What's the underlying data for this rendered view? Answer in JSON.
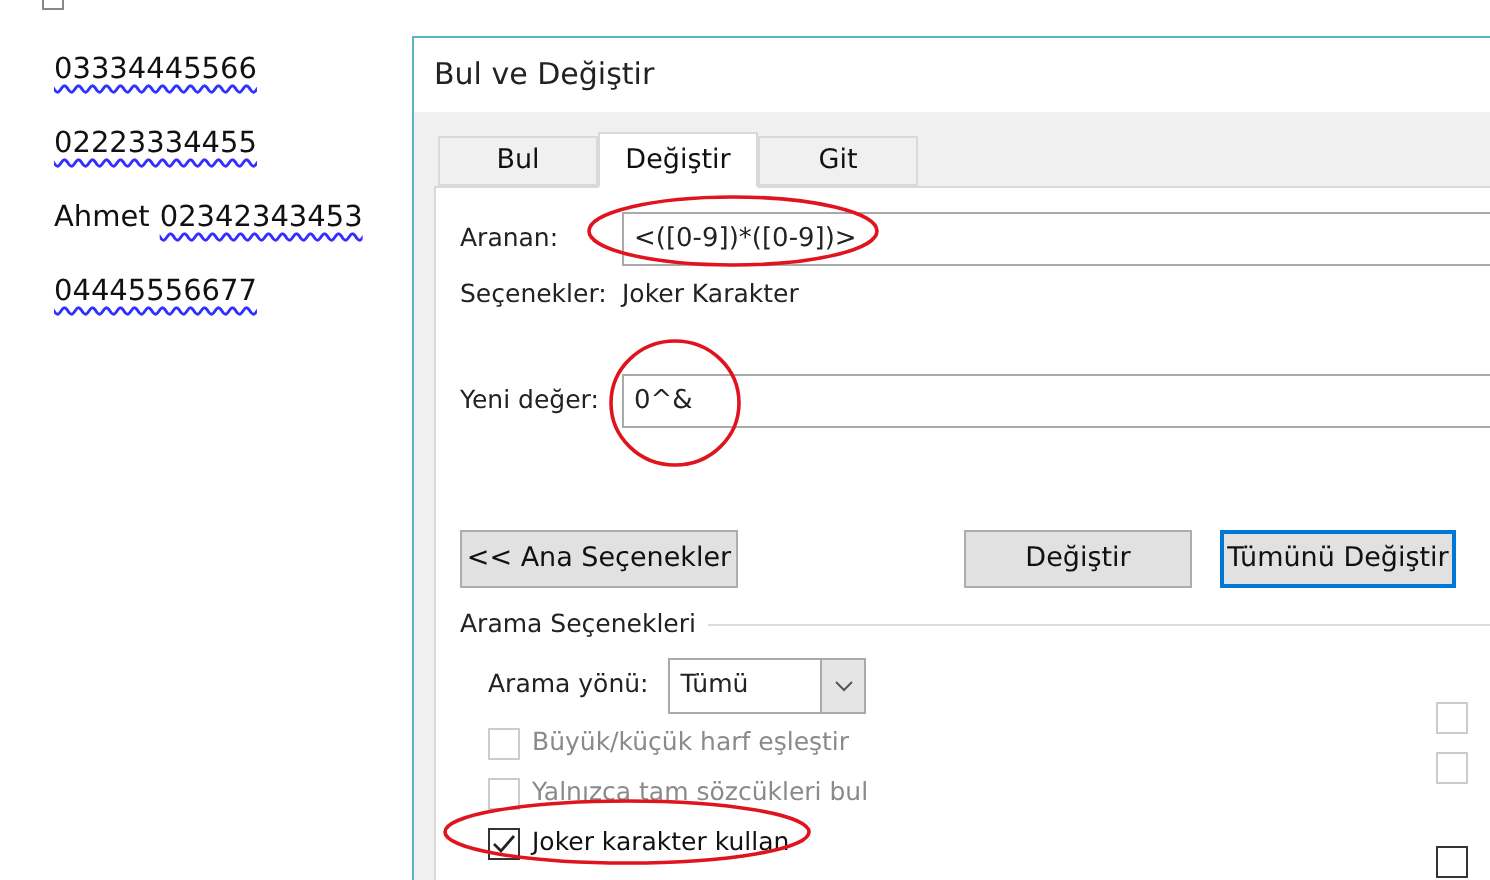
{
  "document": {
    "paragraphs": [
      {
        "words": [
          {
            "text": "03334445566",
            "flagged": true
          }
        ]
      },
      {
        "words": [
          {
            "text": "02223334455",
            "flagged": true
          }
        ]
      },
      {
        "words": [
          {
            "text": "Ahmet",
            "flagged": false
          },
          {
            "text": "02342343453",
            "flagged": true
          }
        ]
      },
      {
        "words": [
          {
            "text": "04445556677",
            "flagged": true
          }
        ]
      }
    ]
  },
  "dialog": {
    "title": "Bul ve Değiştir",
    "tabs": [
      {
        "label": "Bul",
        "selected": false
      },
      {
        "label": "Değiştir",
        "selected": true
      },
      {
        "label": "Git",
        "selected": false
      }
    ],
    "find": {
      "label": "Aranan:",
      "value": "<([0-9])*([0-9])>"
    },
    "options": {
      "label": "Seçenekler:",
      "value": "Joker Karakter"
    },
    "replace": {
      "label": "Yeni değer:",
      "value": "0^&"
    },
    "buttons": [
      {
        "label": "<< Ana Seçenekler",
        "default": false
      },
      {
        "label": "Değiştir",
        "default": false
      },
      {
        "label": "Tümünü Değiştir",
        "default": true
      }
    ],
    "search_options": {
      "title": "Arama Seçenekleri",
      "direction_label": "Arama yönü:",
      "direction_value": "Tümü",
      "checkboxes": [
        {
          "label": "Büyük/küçük harf eşleştir",
          "checked": false,
          "disabled": true
        },
        {
          "label": "Yalnızca tam sözcükleri bul",
          "checked": false,
          "disabled": true
        },
        {
          "label": "Joker karakter kullan",
          "checked": true,
          "disabled": false
        }
      ],
      "right_checkboxes": [
        {
          "checked": false,
          "disabled": true
        },
        {
          "checked": false,
          "disabled": true
        },
        {
          "checked": false,
          "disabled": false
        }
      ]
    }
  }
}
